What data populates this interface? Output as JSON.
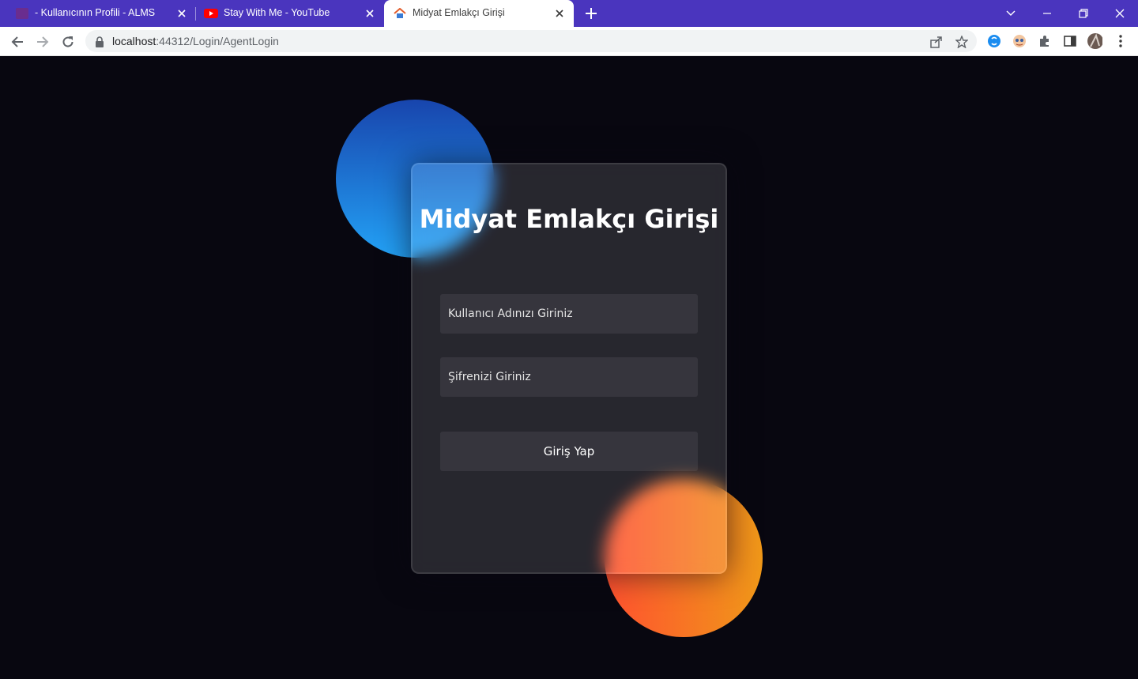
{
  "browser": {
    "tabs": [
      {
        "title": "- Kullanıcının Profili - ALMS",
        "favicon": "purple-square-icon",
        "active": false
      },
      {
        "title": "Stay With Me - YouTube",
        "favicon": "youtube-icon",
        "active": false
      },
      {
        "title": "Midyat Emlakçı Girişi",
        "favicon": "house-icon",
        "active": true
      }
    ],
    "url_host": "localhost",
    "url_path": ":44312/Login/AgentLogin",
    "colors": {
      "tabstrip": "#4a35be",
      "active_tab": "#ffffff"
    }
  },
  "page": {
    "title": "Midyat Emlakçı Girişi",
    "username_placeholder": "Kullanıcı Adınızı Giriniz",
    "password_placeholder": "Şifrenizi Giriniz",
    "login_button": "Giriş Yap",
    "colors": {
      "background": "#080710",
      "blue_gradient": [
        "#1845ad",
        "#23a2f6"
      ],
      "orange_gradient": [
        "#ff512f",
        "#f09819"
      ]
    }
  }
}
